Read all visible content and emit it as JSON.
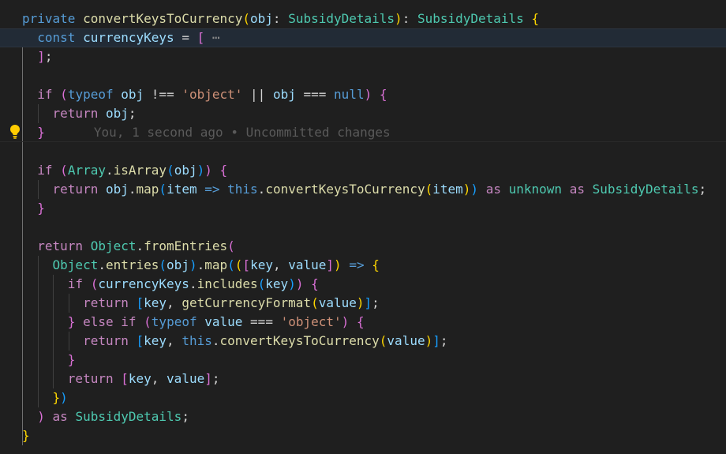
{
  "editor": {
    "language": "typescript",
    "blame": {
      "author": "You",
      "time": "1 second ago",
      "separator": "•",
      "status": "Uncommitted changes"
    },
    "colors": {
      "background": "#1f1f1f",
      "keyword": "#569cd6",
      "control": "#c586c0",
      "function": "#dcdcaa",
      "variable": "#9cdcfe",
      "type": "#4ec9b0",
      "string": "#ce9178",
      "bracket_level1": "#ffd700",
      "bracket_level2": "#da70d6",
      "bracket_level3": "#179fff",
      "lightbulb": "#ffcc00"
    },
    "icons": [
      "lightbulb-icon",
      "fold-ellipsis-icon"
    ],
    "lines": [
      {
        "text": "private convertKeysToCurrency(obj: SubsidyDetails): SubsidyDetails {"
      },
      {
        "text": "  const currencyKeys = [ ⋯",
        "current": true,
        "folded": true
      },
      {
        "text": "  ];"
      },
      {
        "text": ""
      },
      {
        "text": "  if (typeof obj !== 'object' || obj === null) {"
      },
      {
        "text": "    return obj;"
      },
      {
        "text": "  }",
        "blame": true,
        "lightbulb": true
      },
      {
        "text": ""
      },
      {
        "text": "  if (Array.isArray(obj)) {"
      },
      {
        "text": "    return obj.map(item => this.convertKeysToCurrency(item)) as unknown as SubsidyDetails;"
      },
      {
        "text": "  }"
      },
      {
        "text": ""
      },
      {
        "text": "  return Object.fromEntries("
      },
      {
        "text": "    Object.entries(obj).map(([key, value]) => {"
      },
      {
        "text": "      if (currencyKeys.includes(key)) {"
      },
      {
        "text": "        return [key, getCurrencyFormat(value)];"
      },
      {
        "text": "      } else if (typeof value === 'object') {"
      },
      {
        "text": "        return [key, this.convertKeysToCurrency(value)];"
      },
      {
        "text": "      }"
      },
      {
        "text": "      return [key, value];"
      },
      {
        "text": "    })"
      },
      {
        "text": "  ) as SubsidyDetails;"
      },
      {
        "text": "}"
      }
    ]
  }
}
